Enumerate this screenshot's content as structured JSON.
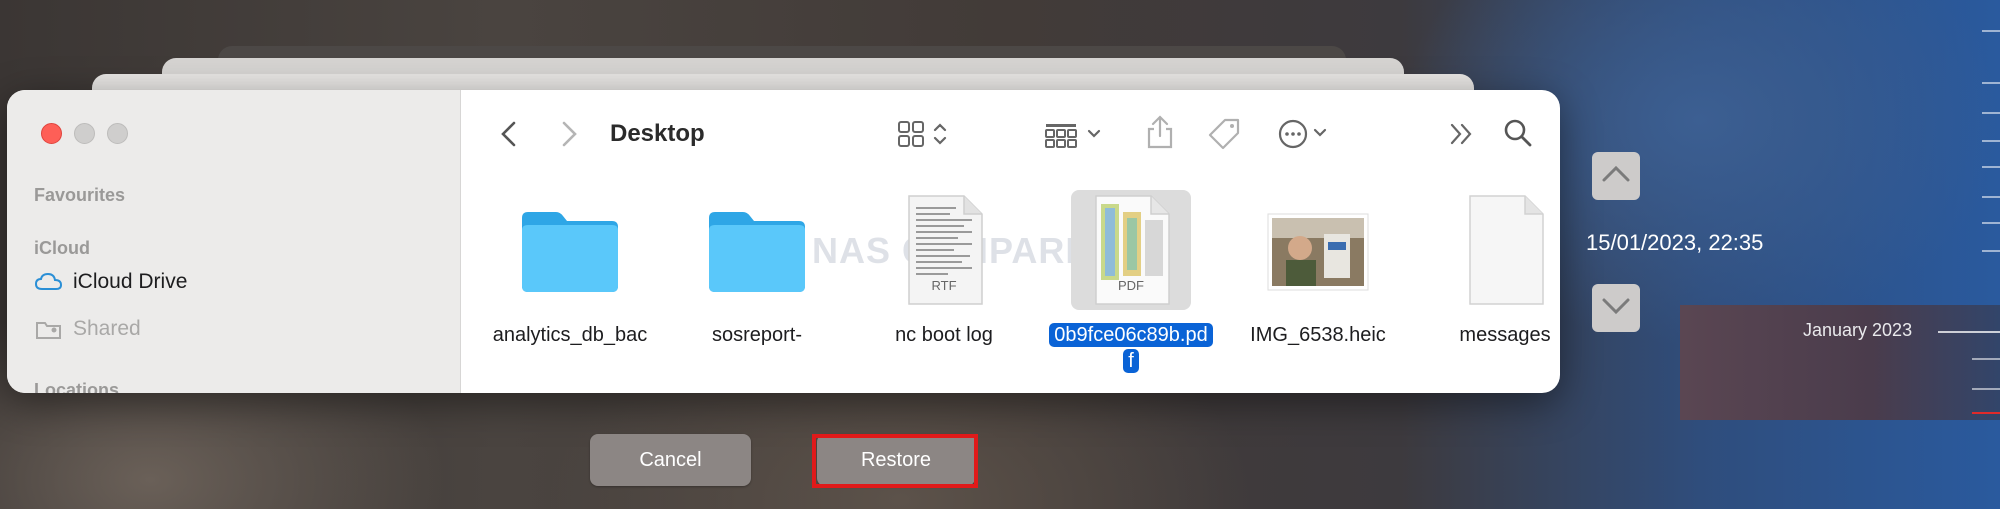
{
  "toolbar": {
    "title": "Desktop"
  },
  "sidebar": {
    "sections": [
      {
        "heading": "Favourites"
      },
      {
        "heading": "iCloud"
      }
    ],
    "items": [
      {
        "label": "iCloud Drive"
      },
      {
        "label": "Shared"
      }
    ],
    "partial_heading": "Locations"
  },
  "files": [
    {
      "name": "analytics_db_bac",
      "type": "folder"
    },
    {
      "name": "sosreport-",
      "type": "folder"
    },
    {
      "name": "nc boot log",
      "type": "rtf",
      "badge": "RTF"
    },
    {
      "name": "0b9fce06c89b.pdf",
      "name_line1": "0b9fce06c89b.pd",
      "name_line2": "f",
      "type": "pdf",
      "badge": "PDF",
      "selected": true
    },
    {
      "name": "IMG_6538.heic",
      "type": "image"
    },
    {
      "name": "messages",
      "type": "document"
    }
  ],
  "watermark": "NAS COMPARES",
  "time_machine": {
    "datestamp": "15/01/2023, 22:35",
    "timeline_label": "January 2023"
  },
  "buttons": {
    "cancel": "Cancel",
    "restore": "Restore"
  },
  "colors": {
    "selection": "#0a63d6",
    "folder": "#5ac8fa",
    "close": "#fe5f57",
    "highlight_outline": "#e01a1a"
  }
}
